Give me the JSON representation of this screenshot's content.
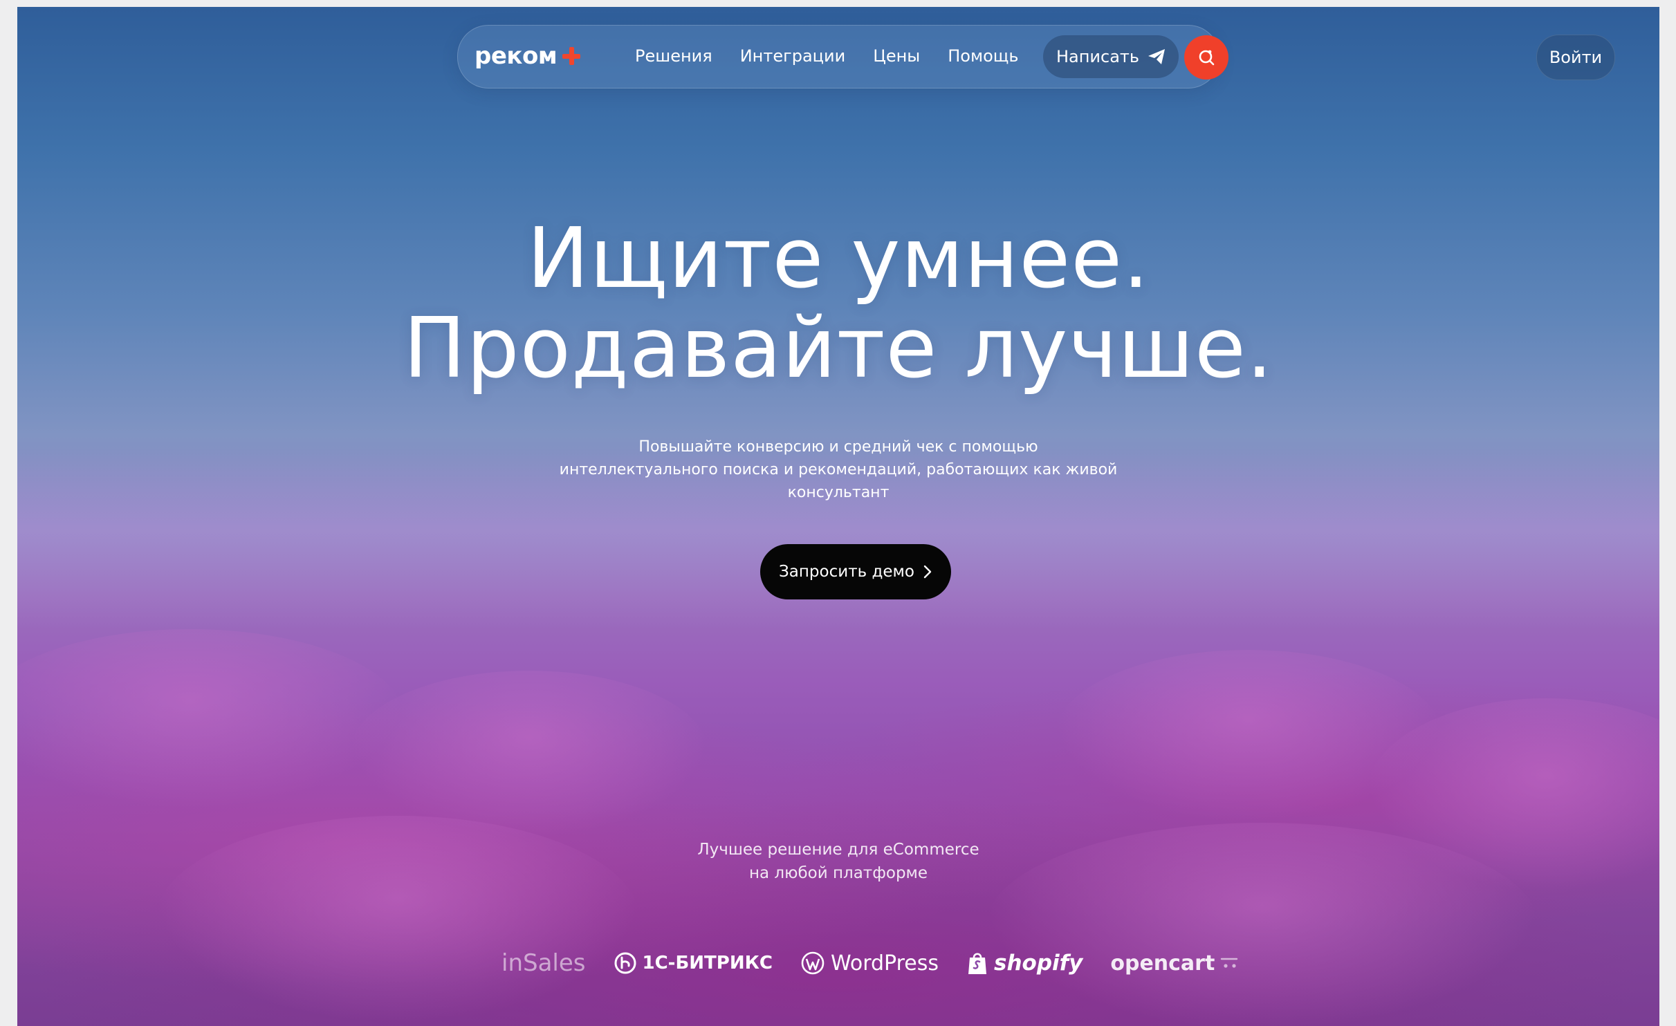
{
  "header": {
    "logo_text": "реком",
    "nav": [
      "Решения",
      "Интеграции",
      "Цены",
      "Помощь"
    ],
    "write_label": "Написать",
    "login_label": "Войти"
  },
  "hero": {
    "title_line1": "Ищите умнее.",
    "title_line2": "Продавайте лучше.",
    "subtitle_line1": "Повышайте конверсию и средний чек с помощью",
    "subtitle_line2": "интеллектуального поиска и рекомендаций, работающих как живой",
    "subtitle_line3": "консультант",
    "cta_label": "Запросить демо"
  },
  "platforms_section": {
    "tagline_line1": "Лучшее решение для eCommerce",
    "tagline_line2": "на любой платформе",
    "logos": [
      "inSales",
      "1С-БИТРИКС",
      "WordPress",
      "shopify",
      "opencart"
    ]
  },
  "colors": {
    "accent": "#f0402a",
    "cta_bg": "#060606",
    "sky_top": "#2f5e9a",
    "field": "#9250b0"
  },
  "icons": {
    "logo_mark": "plus-icon",
    "write": "send-icon",
    "search": "search-icon",
    "cta": "chevron-right-icon"
  }
}
